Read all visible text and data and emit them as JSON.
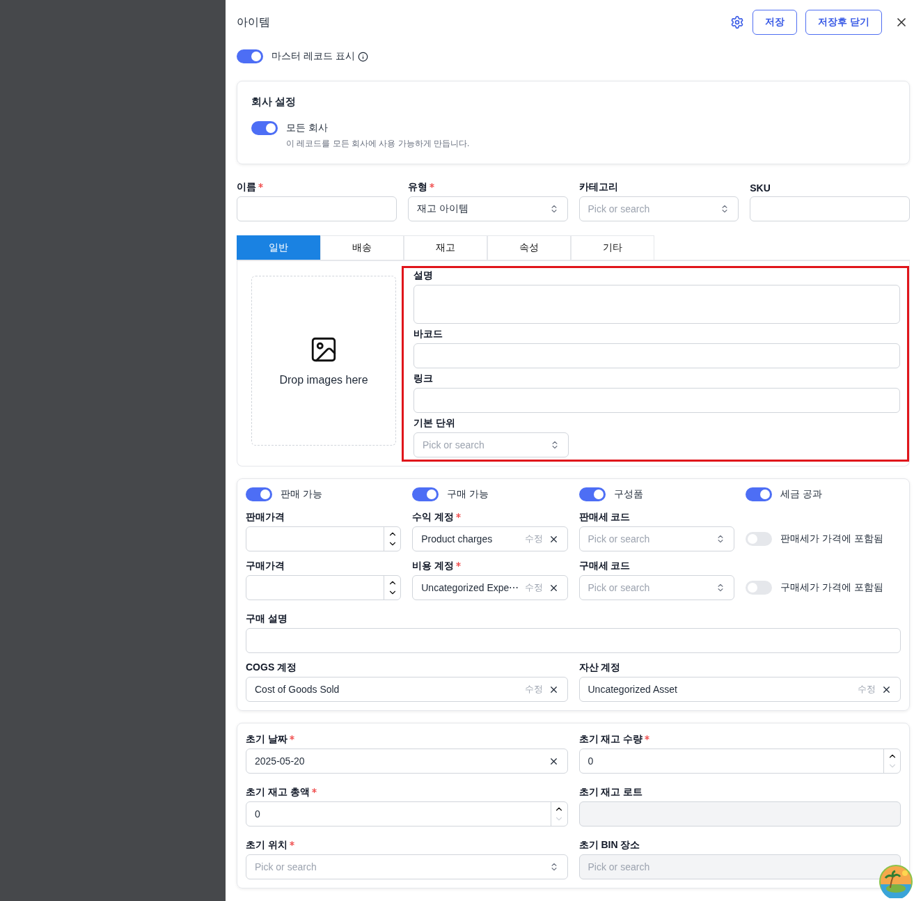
{
  "header": {
    "title": "아이템",
    "buttons": [
      "저장",
      "저장후 닫기"
    ]
  },
  "master_toggle": {
    "label": "마스터 레코드 표시",
    "on": true
  },
  "company": {
    "title": "회사 설정",
    "toggle_label": "모든 회사",
    "on": true,
    "hint": "이 레코드를 모든 회사에 사용 가능하게 만듭니다."
  },
  "top_fields": [
    {
      "label": "이름",
      "required": true,
      "kind": "text"
    },
    {
      "label": "유형",
      "required": true,
      "kind": "select",
      "value": "재고 아이템"
    },
    {
      "label": "카테고리",
      "kind": "select",
      "placeholder": "Pick or search"
    },
    {
      "label": "SKU",
      "kind": "text"
    }
  ],
  "tabs": [
    {
      "label": "일반",
      "selected": true
    },
    {
      "label": "배송",
      "selected": false
    },
    {
      "label": "재고",
      "selected": false
    },
    {
      "label": "속성",
      "selected": false
    },
    {
      "label": "기타",
      "selected": false
    }
  ],
  "general": {
    "dropzone": "Drop images here",
    "highlighted": true,
    "fields": [
      {
        "label": "설명",
        "kind": "textarea"
      },
      {
        "label": "바코드",
        "kind": "text"
      },
      {
        "label": "링크",
        "kind": "text"
      },
      {
        "label": "기본 단위",
        "kind": "select",
        "placeholder": "Pick or search"
      }
    ]
  },
  "sales": {
    "toggles": [
      {
        "label": "판매 가능",
        "on": true
      },
      {
        "label": "구매 가능",
        "on": true
      },
      {
        "label": "구성품",
        "on": true
      },
      {
        "label": "세금 공과",
        "on": true
      }
    ],
    "rows": [
      [
        {
          "label": "판매가격",
          "kind": "number"
        },
        {
          "label": "수익 계정",
          "required": true,
          "kind": "account",
          "value": "Product charges",
          "edit_label": "수정"
        },
        {
          "label": "판매세 코드",
          "kind": "select",
          "placeholder": "Pick or search"
        },
        {
          "label": "판매세가 가격에 포함됨",
          "kind": "switch",
          "on": false
        }
      ],
      [
        {
          "label": "구매가격",
          "kind": "number"
        },
        {
          "label": "비용 계정",
          "required": true,
          "kind": "account",
          "value": "Uncategorized Expe⋯",
          "edit_label": "수정"
        },
        {
          "label": "구매세 코드",
          "kind": "select",
          "placeholder": "Pick or search"
        },
        {
          "label": "구매세가 가격에 포함됨",
          "kind": "switch",
          "on": false
        }
      ]
    ],
    "description": {
      "label": "구매 설명"
    },
    "accounts": [
      {
        "label": "COGS 계정",
        "value": "Cost of Goods Sold",
        "edit_label": "수정"
      },
      {
        "label": "자산 계정",
        "value": "Uncategorized Asset",
        "edit_label": "수정"
      }
    ]
  },
  "opening": {
    "fields": [
      {
        "label": "초기 날짜",
        "required": true,
        "kind": "date",
        "value": "2025-05-20"
      },
      {
        "label": "초기 재고 수량",
        "required": true,
        "kind": "number",
        "value": "0",
        "down_disabled": true
      },
      {
        "label": "초기 재고 총액",
        "required": true,
        "kind": "number",
        "value": "0",
        "down_disabled": true
      },
      {
        "label": "초기 재고 로트",
        "kind": "text",
        "disabled": true
      },
      {
        "label": "초기 위치",
        "required": true,
        "kind": "select",
        "placeholder": "Pick or search"
      },
      {
        "label": "초기 BIN 장소",
        "kind": "select",
        "placeholder": "Pick or search",
        "disabled": true
      }
    ]
  }
}
